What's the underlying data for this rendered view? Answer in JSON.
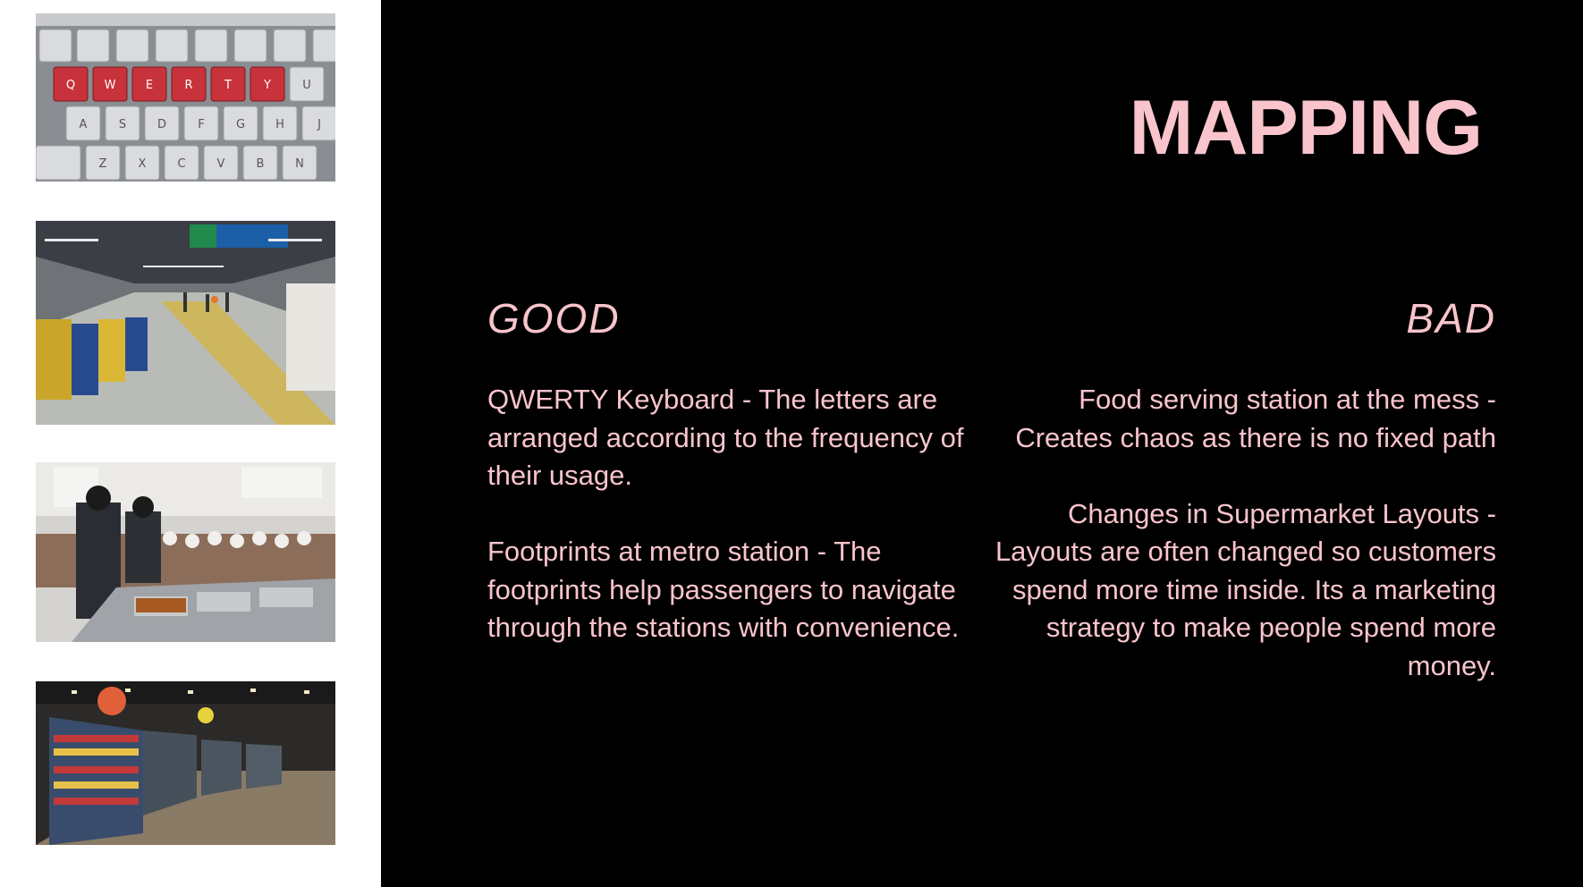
{
  "slide": {
    "title": "MAPPING",
    "good": {
      "heading": "GOOD",
      "items": [
        "QWERTY Keyboard - The letters are arranged according to the frequency of their usage.",
        "Footprints at metro station - The footprints help passengers to navigate through the stations with convenience."
      ]
    },
    "bad": {
      "heading": "BAD",
      "items": [
        "Food serving station at the mess - Creates chaos as there is no fixed path",
        "Changes in Supermarket Layouts - Layouts are often changed so customers spend more time inside. Its a marketing strategy to make people spend more money."
      ]
    },
    "keyboard_keys": [
      "Q",
      "W",
      "E",
      "R",
      "T",
      "Y",
      "U",
      "A",
      "S",
      "D",
      "F",
      "G",
      "H",
      "J",
      "Z",
      "X",
      "C",
      "V",
      "B",
      "N"
    ],
    "colors": {
      "background": "#000000",
      "accent_pink": "#f9c4cc",
      "key_red": "#c8323a"
    }
  }
}
